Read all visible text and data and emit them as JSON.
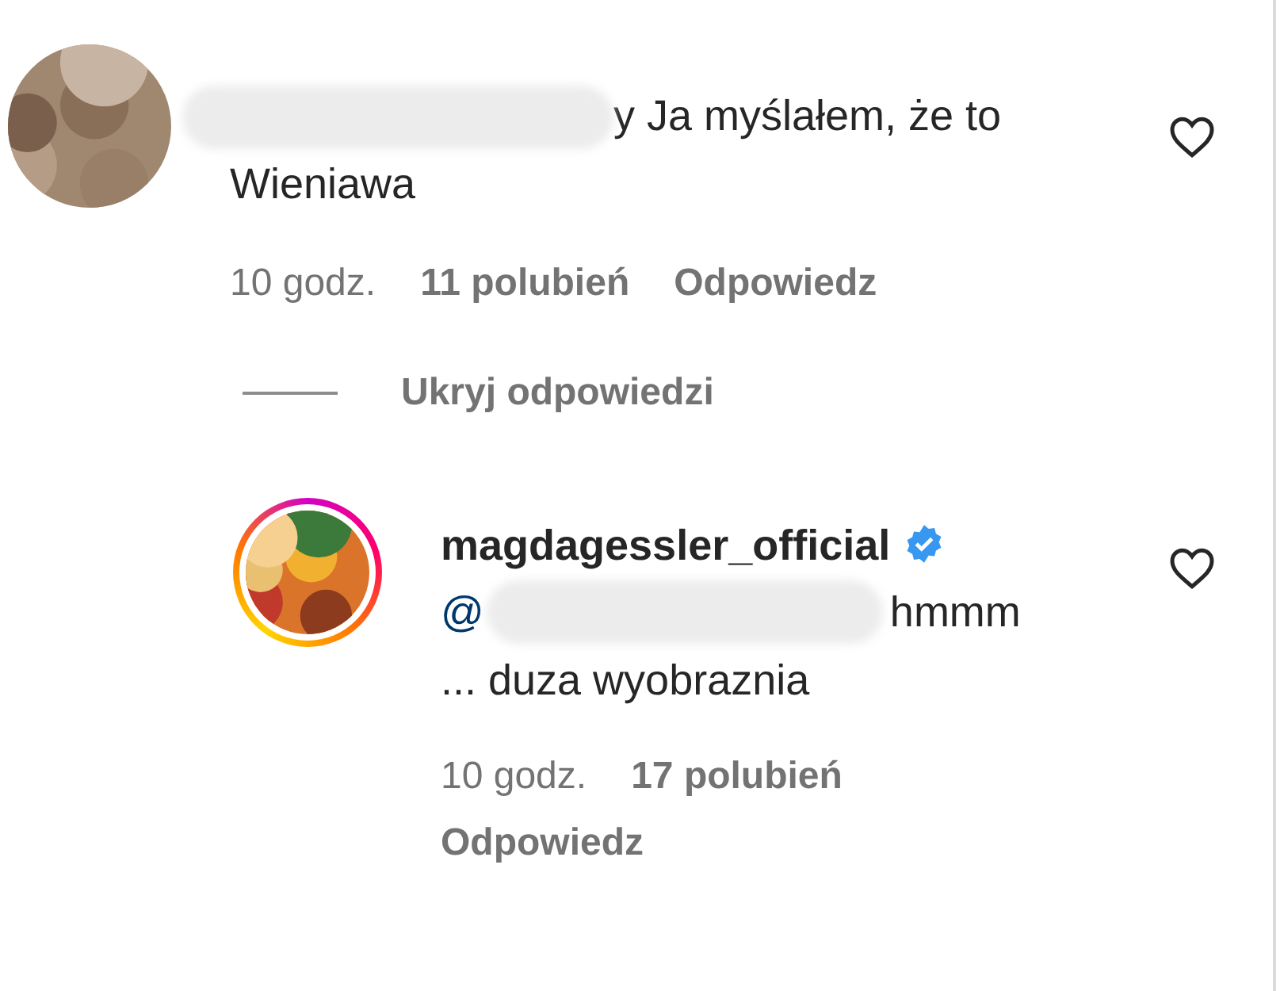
{
  "comment": {
    "username_redacted": true,
    "text_lines": [
      "y Ja myślałem, że to",
      "Wieniawa"
    ],
    "liked": false,
    "time": "10 godz.",
    "likes": "11 polubień",
    "reply_label": "Odpowiedz"
  },
  "hide_replies": "Ukryj odpowiedzi",
  "replies": [
    {
      "username": "magdagessler_official",
      "verified": true,
      "mention": "@",
      "mention_redacted": true,
      "text_lines": [
        "hmmm",
        "... duza wyobraznia"
      ],
      "liked": false,
      "time": "10 godz.",
      "likes": "17 polubień",
      "reply_label": "Odpowiedz"
    }
  ]
}
